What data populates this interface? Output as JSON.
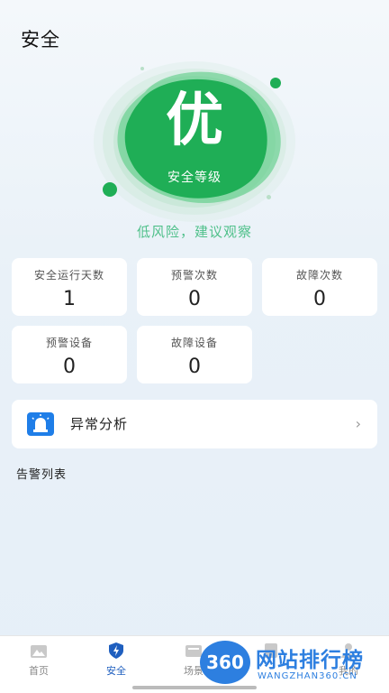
{
  "header": {
    "title": "安全"
  },
  "grade": {
    "value": "优",
    "label": "安全等级",
    "risk_text": "低风险，建议观察"
  },
  "stats": [
    {
      "label": "安全运行天数",
      "value": "1"
    },
    {
      "label": "预警次数",
      "value": "0"
    },
    {
      "label": "故障次数",
      "value": "0"
    },
    {
      "label": "预警设备",
      "value": "0"
    },
    {
      "label": "故障设备",
      "value": "0"
    }
  ],
  "analysis": {
    "title": "异常分析"
  },
  "alarm_list": {
    "title": "告警列表"
  },
  "tabs": [
    {
      "label": "首页",
      "icon": "home-icon"
    },
    {
      "label": "安全",
      "icon": "shield-bolt-icon",
      "active": true
    },
    {
      "label": "场景",
      "icon": "scene-icon"
    },
    {
      "label": "",
      "icon": "device-icon"
    },
    {
      "label": "我的",
      "icon": "user-icon"
    }
  ],
  "watermark": {
    "logo": "360",
    "title": "网站排行榜",
    "subtitle": "WANGZHAN360.CN"
  },
  "colors": {
    "green": "#1fae56",
    "accent_blue": "#1f7ee8",
    "risk_text": "#4fc08a"
  }
}
